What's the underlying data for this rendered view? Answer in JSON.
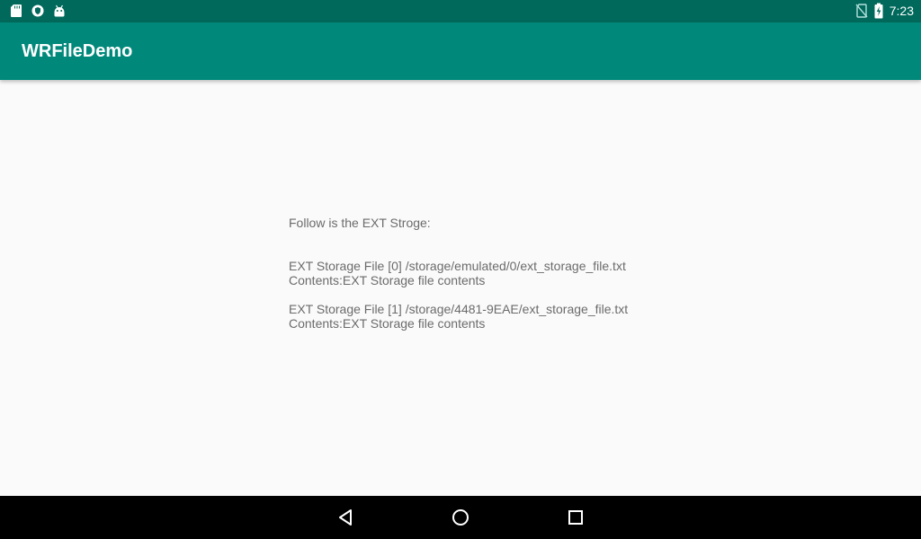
{
  "status_bar": {
    "left_icons": [
      "sd-card-icon",
      "shield-icon",
      "android-icon"
    ],
    "right_icons": [
      "no-sim-icon",
      "battery-charging-icon"
    ],
    "time": "7:23"
  },
  "app_bar": {
    "title": "WRFileDemo",
    "background": "#00897b",
    "status_background": "#00695c"
  },
  "content": {
    "heading": "Follow is the EXT Stroge:",
    "files": [
      {
        "path_line": "EXT Storage File [0] /storage/emulated/0/ext_storage_file.txt",
        "contents_line": "Contents:EXT Storage file contents"
      },
      {
        "path_line": "EXT Storage File [1] /storage/4481-9EAE/ext_storage_file.txt",
        "contents_line": "Contents:EXT Storage file contents"
      }
    ]
  },
  "nav_bar": {
    "buttons": [
      "back-icon",
      "home-icon",
      "recents-icon"
    ]
  }
}
